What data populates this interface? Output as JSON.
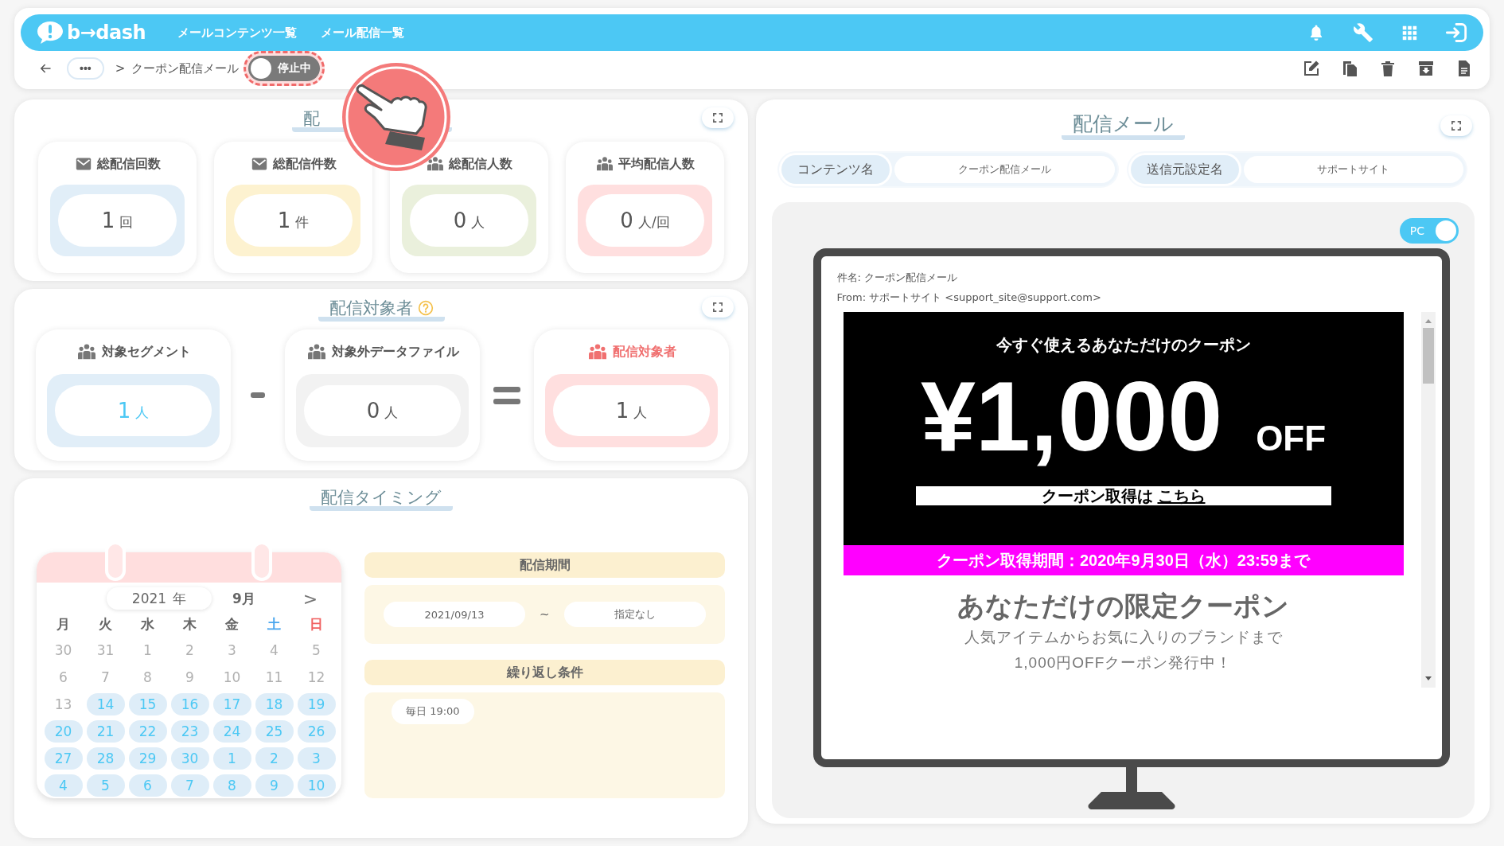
{
  "header": {
    "logo": "b→dash",
    "nav": [
      {
        "label": "メールコンテンツ一覧"
      },
      {
        "label": "メール配信一覧"
      }
    ]
  },
  "breadcrumb": {
    "more": "•••",
    "separator": ">",
    "current": "クーポン配信メール",
    "status_toggle": {
      "label": "停止中",
      "on": false
    }
  },
  "delivery_stats": {
    "title": "配",
    "cards": [
      {
        "kind": "mail",
        "label": "総配信回数",
        "value": "1",
        "unit": "回",
        "color": "#e1eef8"
      },
      {
        "kind": "mail",
        "label": "総配信件数",
        "value": "1",
        "unit": "件",
        "color": "#fdf2d0"
      },
      {
        "kind": "people",
        "label": "総配信人数",
        "value": "0",
        "unit": "人",
        "color": "#eaf0dc"
      },
      {
        "kind": "people",
        "label": "平均配信人数",
        "value": "0",
        "unit": "人/回",
        "color": "#ffdfdf"
      }
    ]
  },
  "audience": {
    "title": "配信対象者",
    "cards": [
      {
        "kind": "segment",
        "label": "対象セグメント",
        "value": "1",
        "unit": "人"
      },
      {
        "kind": "excluded",
        "label": "対象外データファイル",
        "value": "0",
        "unit": "人"
      },
      {
        "kind": "result",
        "label": "配信対象者",
        "value": "1",
        "unit": "人"
      }
    ]
  },
  "timing": {
    "title": "配信タイミング",
    "calendar": {
      "year": "2021",
      "year_unit": "年",
      "month": "9月",
      "next": ">",
      "weekdays": [
        {
          "label": "月",
          "kind": "weekday"
        },
        {
          "label": "火",
          "kind": "weekday"
        },
        {
          "label": "水",
          "kind": "weekday"
        },
        {
          "label": "木",
          "kind": "weekday"
        },
        {
          "label": "金",
          "kind": "weekday"
        },
        {
          "label": "土",
          "kind": "saturday"
        },
        {
          "label": "日",
          "kind": "sunday"
        }
      ],
      "weeks": [
        [
          {
            "day": "30",
            "highlighted": false
          },
          {
            "day": "31",
            "highlighted": false
          },
          {
            "day": "1",
            "highlighted": false
          },
          {
            "day": "2",
            "highlighted": false
          },
          {
            "day": "3",
            "highlighted": false
          },
          {
            "day": "4",
            "highlighted": false
          },
          {
            "day": "5",
            "highlighted": false
          }
        ],
        [
          {
            "day": "6",
            "highlighted": false
          },
          {
            "day": "7",
            "highlighted": false
          },
          {
            "day": "8",
            "highlighted": false
          },
          {
            "day": "9",
            "highlighted": false
          },
          {
            "day": "10",
            "highlighted": false
          },
          {
            "day": "11",
            "highlighted": false
          },
          {
            "day": "12",
            "highlighted": false
          }
        ],
        [
          {
            "day": "13",
            "highlighted": false
          },
          {
            "day": "14",
            "highlighted": true
          },
          {
            "day": "15",
            "highlighted": true
          },
          {
            "day": "16",
            "highlighted": true
          },
          {
            "day": "17",
            "highlighted": true
          },
          {
            "day": "18",
            "highlighted": true
          },
          {
            "day": "19",
            "highlighted": true
          }
        ],
        [
          {
            "day": "20",
            "highlighted": true
          },
          {
            "day": "21",
            "highlighted": true
          },
          {
            "day": "22",
            "highlighted": true
          },
          {
            "day": "23",
            "highlighted": true
          },
          {
            "day": "24",
            "highlighted": true
          },
          {
            "day": "25",
            "highlighted": true
          },
          {
            "day": "26",
            "highlighted": true
          }
        ],
        [
          {
            "day": "27",
            "highlighted": true
          },
          {
            "day": "28",
            "highlighted": true
          },
          {
            "day": "29",
            "highlighted": true
          },
          {
            "day": "30",
            "highlighted": true
          },
          {
            "day": "1",
            "highlighted": true
          },
          {
            "day": "2",
            "highlighted": true
          },
          {
            "day": "3",
            "highlighted": true
          }
        ],
        [
          {
            "day": "4",
            "highlighted": true
          },
          {
            "day": "5",
            "highlighted": true
          },
          {
            "day": "6",
            "highlighted": true
          },
          {
            "day": "7",
            "highlighted": true
          },
          {
            "day": "8",
            "highlighted": true
          },
          {
            "day": "9",
            "highlighted": true
          },
          {
            "day": "10",
            "highlighted": true
          }
        ]
      ]
    },
    "period": {
      "title": "配信期間",
      "start": "2021/09/13",
      "separator": "~",
      "end": "指定なし"
    },
    "repeat": {
      "title": "繰り返し条件",
      "rules": [
        "毎日 19:00"
      ]
    }
  },
  "mail": {
    "title": "配信メール",
    "fields": [
      {
        "label": "コンテンツ名",
        "value": "クーポン配信メール"
      },
      {
        "label": "送信元設定名",
        "value": "サポートサイト"
      }
    ],
    "preview": {
      "device_toggle": {
        "label": "PC",
        "on": true
      },
      "subject": "件名: クーポン配信メール",
      "from": "From: サポートサイト <support_site@support.com>",
      "banner_title": "今すぐ使えるあなただけのクーポン",
      "amount": "¥1,000",
      "amount_suffix": "OFF",
      "cta_text": "クーポン取得は",
      "cta_link": "こちら",
      "period": "クーポン取得期間：2020年9月30日（水）23:59まで",
      "headline": "あなただけの限定クーポン",
      "body": [
        "人気アイテムからお気に入りのブランドまで",
        "1,000円OFFクーポン発行中！"
      ]
    }
  }
}
